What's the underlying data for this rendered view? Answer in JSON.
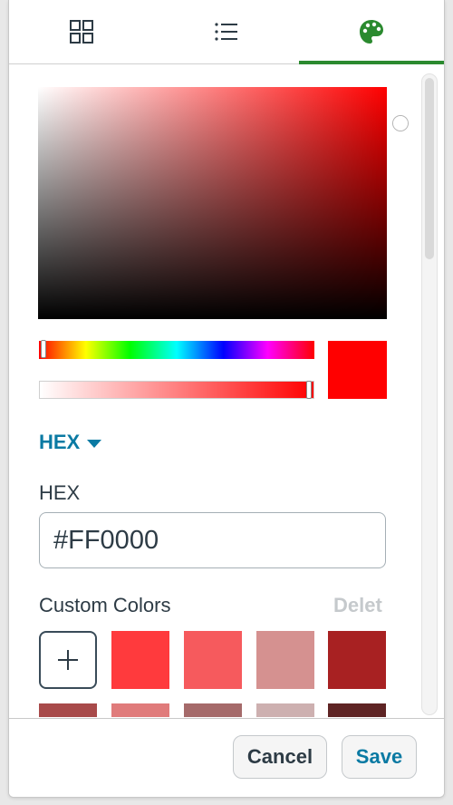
{
  "tabs": [
    {
      "id": "grid",
      "icon": "grid-icon"
    },
    {
      "id": "list",
      "icon": "list-icon"
    },
    {
      "id": "palette",
      "icon": "palette-icon",
      "active": true
    }
  ],
  "picker": {
    "current_color": "#FF0000",
    "hue_level": 0,
    "alpha_level": 1.0,
    "format_toggle_label": "HEX",
    "hex_label": "HEX",
    "hex_value": "#FF0000"
  },
  "custom_colors": {
    "title": "Custom Colors",
    "delete_label": "Delet",
    "swatches": [
      "#FF3A3D",
      "#F65A5D",
      "#D59190",
      "#A82122",
      "#A84A4A",
      "#E07B7B",
      "#A56A6A",
      "#CDB0B0",
      "#5E2424"
    ]
  },
  "footer": {
    "cancel_label": "Cancel",
    "save_label": "Save"
  },
  "colors": {
    "accent_green": "#2B8A2F",
    "link_blue": "#0A7AA3",
    "text_dark": "#2D3B45"
  }
}
